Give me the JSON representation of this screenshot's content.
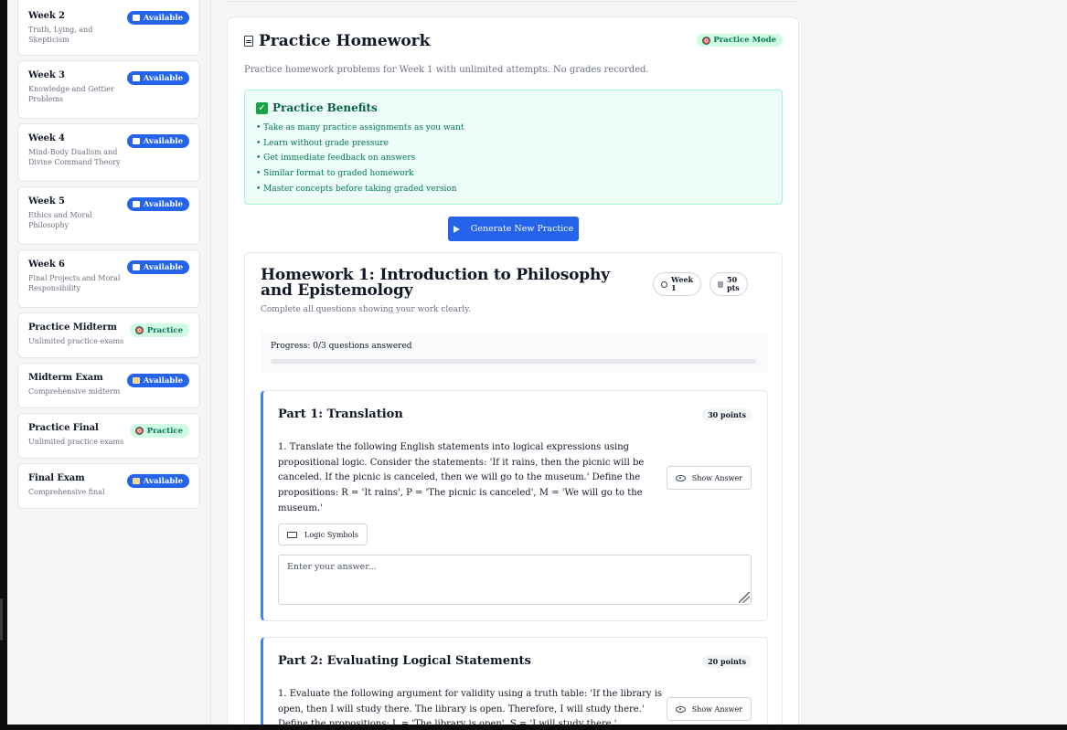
{
  "sidebar": {
    "items": [
      {
        "title": "Week 2",
        "sub": "Truth, Lying, and Skepticism",
        "badge": "Available",
        "badge_type": "available"
      },
      {
        "title": "Week 3",
        "sub": "Knowledge and Gettier Problems",
        "badge": "Available",
        "badge_type": "available"
      },
      {
        "title": "Week 4",
        "sub": "Mind-Body Dualism and Divine Command Theory",
        "badge": "Available",
        "badge_type": "available"
      },
      {
        "title": "Week 5",
        "sub": "Ethics and Moral Philosophy",
        "badge": "Available",
        "badge_type": "available"
      },
      {
        "title": "Week 6",
        "sub": "Final Projects and Moral Responsibility",
        "badge": "Available",
        "badge_type": "available"
      },
      {
        "title": "Practice Midterm",
        "sub": "Unlimited practice exams",
        "badge": "Practice",
        "badge_type": "practice"
      },
      {
        "title": "Midterm Exam",
        "sub": "Comprehensive midterm",
        "badge": "Available",
        "badge_type": "exam"
      },
      {
        "title": "Practice Final",
        "sub": "Unlimited practice exams",
        "badge": "Practice",
        "badge_type": "practice"
      },
      {
        "title": "Final Exam",
        "sub": "Comprehensive final",
        "badge": "Available",
        "badge_type": "exam"
      }
    ]
  },
  "panel": {
    "title": "Practice Homework",
    "mode_badge": "Practice Mode",
    "description": "Practice homework problems for Week 1 with unlimited attempts. No grades recorded.",
    "benefits": {
      "title": "Practice Benefits",
      "items": [
        "• Take as many practice assignments as you want",
        "• Learn without grade pressure",
        "• Get immediate feedback on answers",
        "• Similar format to graded homework",
        "• Master concepts before taking graded version"
      ]
    },
    "generate_label": "Generate New Practice"
  },
  "homework": {
    "title": "Homework 1: Introduction to Philosophy and Epistemology",
    "subtitle": "Complete all questions showing your work clearly.",
    "week_pill": "Week 1",
    "points_pill": "50 pts",
    "progress_text": "Progress: 0/3 questions answered",
    "progress_fraction": 0,
    "parts": [
      {
        "title": "Part 1: Translation",
        "points": "30 points",
        "question": "1. Translate the following English statements into logical expressions using propositional logic. Consider the statements: 'If it rains, then the picnic will be canceled. If the picnic is canceled, then we will go to the museum.' Define the propositions: R = 'It rains', P = 'The picnic is canceled', M = 'We will go to the museum.'",
        "show_answer": "Show Answer",
        "symbols_label": "Logic Symbols",
        "answer_placeholder": "Enter your answer..."
      },
      {
        "title": "Part 2: Evaluating Logical Statements",
        "points": "20 points",
        "question": "1. Evaluate the following argument for validity using a truth table: 'If the library is open, then I will study there. The library is open. Therefore, I will study there.' Define the propositions: L = 'The library is open', S = 'I will study there.'",
        "show_answer": "Show Answer"
      }
    ]
  }
}
